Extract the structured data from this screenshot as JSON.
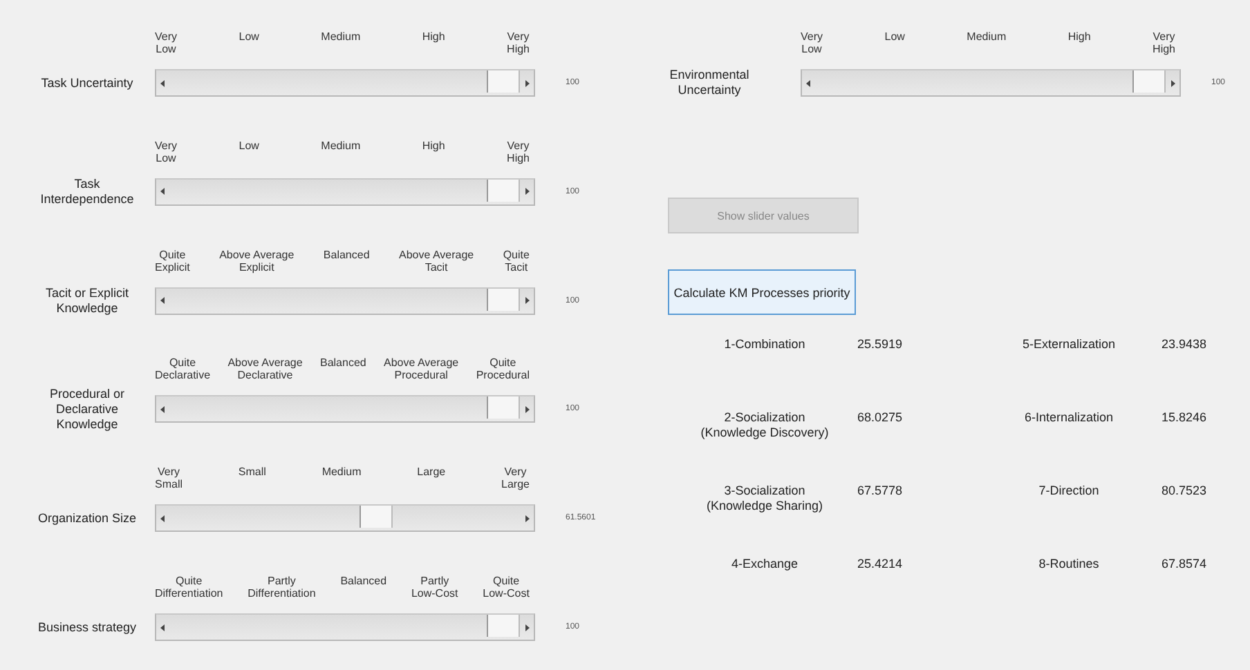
{
  "left_sliders": [
    {
      "label": "Task Uncertainty",
      "ticks": [
        "Very\nLow",
        "Low",
        "Medium",
        "High",
        "Very\nHigh"
      ],
      "level": 1,
      "reading": "100"
    },
    {
      "label": "Task\nInterdependence",
      "ticks": [
        "Very\nLow",
        "Low",
        "Medium",
        "High",
        "Very\nHigh"
      ],
      "level": 1,
      "reading": "100"
    },
    {
      "label": "Tacit or Explicit\nKnowledge",
      "ticks": [
        "Quite\nExplicit",
        "Above Average\nExplicit",
        "Balanced",
        "Above Average\nTacit",
        "Quite\nTacit"
      ],
      "level": 1,
      "reading": "100"
    },
    {
      "label": "Procedural or\nDeclarative\nKnowledge",
      "ticks": [
        "Quite\nDeclarative",
        "Above Average\nDeclarative",
        "Balanced",
        "Above Average\nProcedural",
        "Quite\nProcedural"
      ],
      "level": 1,
      "reading": "100"
    },
    {
      "label": "Organization Size",
      "ticks": [
        "Very\nSmall",
        "Small",
        "Medium",
        "Large",
        "Very\nLarge"
      ],
      "level": 0.6,
      "reading": "61.5601"
    },
    {
      "label": "Business strategy",
      "ticks": [
        "Quite\nDifferentiation",
        "Partly\nDifferentiation",
        "Balanced",
        "Partly\nLow-Cost",
        "Quite\nLow-Cost"
      ],
      "level": 1,
      "reading": "100"
    }
  ],
  "right_slider": {
    "label": "Environmental\nUncertainty",
    "ticks": [
      "Very\nLow",
      "Low",
      "Medium",
      "High",
      "Very\nHigh"
    ],
    "level": 1,
    "reading": "100"
  },
  "show_button": {
    "label": "Show slider values",
    "disabled": true
  },
  "calculate_button": {
    "label": "Calculate KM Processes priority"
  },
  "results": [
    {
      "name": "1-Combination",
      "value": "25.5919"
    },
    {
      "name": "2-Socialization\n(Knowledge Discovery)",
      "value": "68.0275"
    },
    {
      "name": "3-Socialization\n(Knowledge Sharing)",
      "value": "67.5778"
    },
    {
      "name": "4-Exchange",
      "value": "25.4214"
    },
    {
      "name": "5-Externalization",
      "value": "23.9438"
    },
    {
      "name": "6-Internalization",
      "value": "15.8246"
    },
    {
      "name": "7-Direction",
      "value": "80.7523"
    },
    {
      "name": "8-Routines",
      "value": "67.8574"
    }
  ]
}
